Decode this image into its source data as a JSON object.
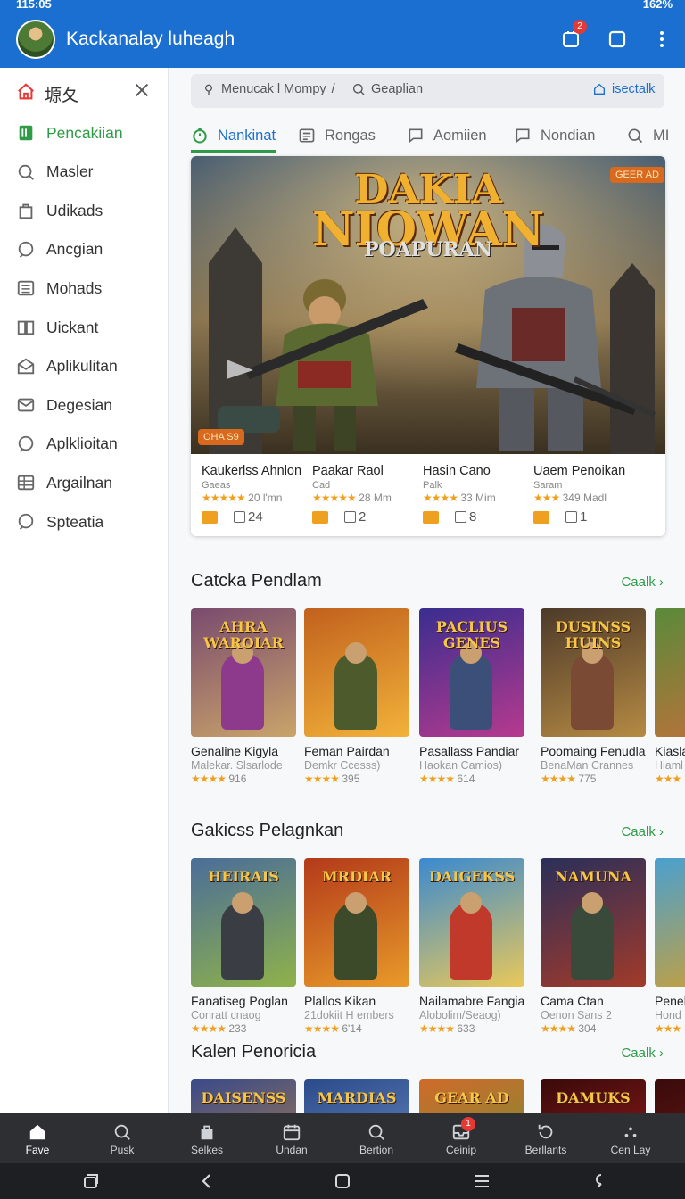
{
  "status": {
    "time": "115:05",
    "right": "162%"
  },
  "appbar": {
    "title": "Kackanalay luheagh",
    "notif_badge": "2"
  },
  "sidebar": {
    "header": "塬夂",
    "items": [
      {
        "label": "Pencakiian",
        "icon": "book-icon",
        "active": true
      },
      {
        "label": "Masler",
        "icon": "search-icon"
      },
      {
        "label": "Udikads",
        "icon": "bag-icon"
      },
      {
        "label": "Ancgian",
        "icon": "chat-icon"
      },
      {
        "label": "Mohads",
        "icon": "list-icon"
      },
      {
        "label": "Uickant",
        "icon": "book-open-icon"
      },
      {
        "label": "Aplikulitan",
        "icon": "mail-open-icon"
      },
      {
        "label": "Degesian",
        "icon": "mail-icon"
      },
      {
        "label": "Aplklioitan",
        "icon": "chat-icon"
      },
      {
        "label": "Argailnan",
        "icon": "grid-icon"
      },
      {
        "label": "Spteatia",
        "icon": "chat-icon"
      }
    ]
  },
  "search": {
    "left": "Menucak l Mompy",
    "middle": "Geaplian",
    "right": "isectalk"
  },
  "tabs": [
    {
      "label": "Nankinat",
      "active": true
    },
    {
      "label": "Rongas"
    },
    {
      "label": "Aomiien"
    },
    {
      "label": "Nondian"
    },
    {
      "label": "MI"
    }
  ],
  "hero": {
    "logo_line1": "DAKIA",
    "logo_line2": "NIOWAN",
    "logo_line3": "POAPURAN",
    "tag_top": "GEER AD",
    "tag_bottom": "OHA S9",
    "items": [
      {
        "title": "Kaukerlss Ahnlon",
        "sub": "Gaeas",
        "stars": "★★★★★",
        "rating": "20 l'mn",
        "count": "24"
      },
      {
        "title": "Paakar Raol",
        "sub": "Cad",
        "stars": "★★★★★",
        "rating": "28 Mm",
        "count": "2"
      },
      {
        "title": "Hasin Cano",
        "sub": "Palk",
        "stars": "★★★★",
        "rating": "33 Mim",
        "count": "8"
      },
      {
        "title": "Uaem Penoikan",
        "sub": "Saram",
        "stars": "★★★",
        "rating": "349 Madl",
        "count": "1"
      }
    ]
  },
  "sections": [
    {
      "title": "Catcka Pendlam",
      "more": "Caalk",
      "cards": [
        {
          "title": "Genaline Kigyla",
          "sub": "Malekar. Slsarlode",
          "stars": "★★★★",
          "rating": "916",
          "logo": "AHRA WAROIAR",
          "c1": "#7a4b6e",
          "c2": "#c9a46a",
          "fig": "#8e3a8c"
        },
        {
          "title": "Feman Pairdan",
          "sub": "Demkr Ccesss)",
          "stars": "★★★★",
          "rating": "395",
          "logo": "",
          "c1": "#c1611d",
          "c2": "#f2b23a",
          "fig": "#4d5a2c"
        },
        {
          "title": "Pasallass Pandiar",
          "sub": "Haokan Camios)",
          "stars": "★★★★",
          "rating": "614",
          "logo": "PACLIUS GENES",
          "c1": "#3a2d8f",
          "c2": "#b63a8e",
          "fig": "#3c4f78"
        },
        {
          "title": "Poomaing Fenudlan",
          "sub": "BenaMan Crannes",
          "stars": "★★★★",
          "rating": "775",
          "logo": "DUSINSS HUINS",
          "c1": "#4d3a2a",
          "c2": "#b58a43",
          "fig": "#7a4a34"
        },
        {
          "title": "Kiasla",
          "sub": "Hiaml",
          "stars": "★★★",
          "rating": "",
          "logo": "",
          "c1": "#5a8a3a",
          "c2": "#c2703a",
          "fig": "#9b3a2a"
        }
      ]
    },
    {
      "title": "Gakicss Pelagnkan",
      "more": "Caalk",
      "cards": [
        {
          "title": "Fanatiseg Poglan",
          "sub": "Conratt cnaog",
          "stars": "★★★★",
          "rating": "233",
          "logo": "HEIRAIS",
          "c1": "#4a6d9a",
          "c2": "#8fb24a",
          "fig": "#3a3d44"
        },
        {
          "title": "Plallos Kikan",
          "sub": "21dokiit H embers",
          "stars": "★★★★",
          "rating": "6'14",
          "logo": "MRDIAR",
          "c1": "#b33a1a",
          "c2": "#e89a2a",
          "fig": "#3d4a2a"
        },
        {
          "title": "Nailamabre Fangian",
          "sub": "Alobolim/Seaog)",
          "stars": "★★★★",
          "rating": "633",
          "logo": "DAIGEKSS",
          "c1": "#3a8ad0",
          "c2": "#e9c85a",
          "fig": "#c0392b"
        },
        {
          "title": "Cama Ctan",
          "sub": "Oenon Sans 2",
          "stars": "★★★★",
          "rating": "304",
          "logo": "NAMUNA",
          "c1": "#2a2f5a",
          "c2": "#a23a2a",
          "fig": "#3a4a3a"
        },
        {
          "title": "Peneb",
          "sub": "Hond",
          "stars": "★★★",
          "rating": "",
          "logo": "",
          "c1": "#4aa0d0",
          "c2": "#d0a030",
          "fig": "#a33a2a"
        }
      ]
    },
    {
      "title": "Kalen Penoricia",
      "more": "Caalk",
      "cards": [
        {
          "title": "",
          "sub": "",
          "stars": "",
          "rating": "",
          "logo": "DAISENSS",
          "c1": "#3a4a8a",
          "c2": "#c28a3a",
          "fig": "#4a3a2a"
        },
        {
          "title": "",
          "sub": "",
          "stars": "",
          "rating": "",
          "logo": "MARDIAS",
          "c1": "#2a4a8a",
          "c2": "#7a9ad0",
          "fig": "#3a3a4a"
        },
        {
          "title": "",
          "sub": "",
          "stars": "",
          "rating": "",
          "logo": "GEAR AD",
          "c1": "#d06a2a",
          "c2": "#5a9a3a",
          "fig": "#4a3a2a"
        },
        {
          "title": "",
          "sub": "",
          "stars": "",
          "rating": "",
          "logo": "DAMUKS",
          "c1": "#3a0a0a",
          "c2": "#b02020",
          "fig": "#2a2a2a"
        },
        {
          "title": "",
          "sub": "",
          "stars": "",
          "rating": "",
          "logo": "",
          "c1": "#3a0a0a",
          "c2": "#802020",
          "fig": "#2a2a2a"
        }
      ]
    }
  ],
  "bottomnav": [
    {
      "label": "Fave",
      "icon": "home-icon",
      "active": true
    },
    {
      "label": "Pusk",
      "icon": "search-icon"
    },
    {
      "label": "Selkes",
      "icon": "bag-icon"
    },
    {
      "label": "Undan",
      "icon": "calendar-icon"
    },
    {
      "label": "Bertion",
      "icon": "search-icon"
    },
    {
      "label": "Ceinip",
      "icon": "inbox-icon",
      "badge": "1"
    },
    {
      "label": "Berllants",
      "icon": "refresh-icon"
    },
    {
      "label": "Cen Lay",
      "icon": "dots-icon"
    }
  ],
  "colors": {
    "appbar": "#1a6fd0",
    "accent_green": "#2e9c47",
    "star": "#f0a020",
    "badge": "#e53935"
  }
}
